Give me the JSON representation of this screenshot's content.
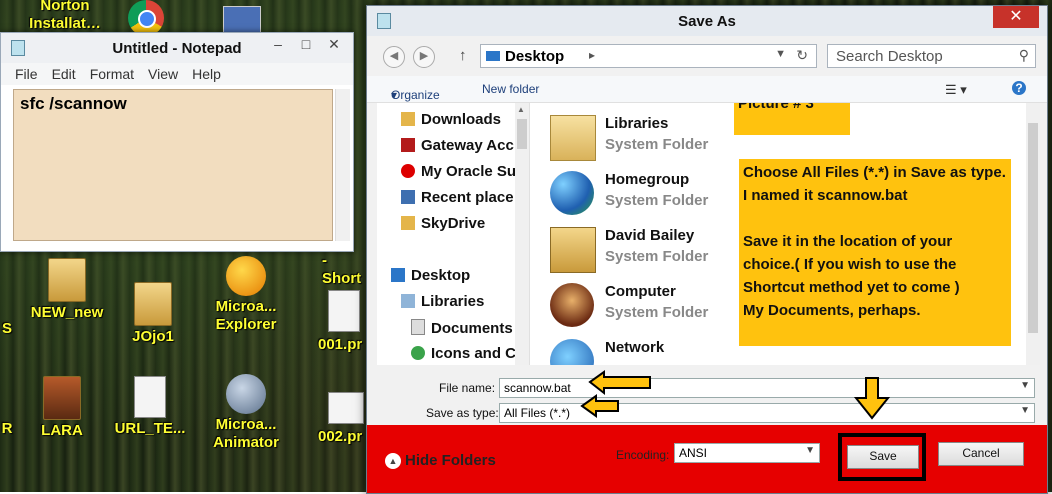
{
  "desktop_icons": [
    {
      "label": "Norton Installat…",
      "kind": "app"
    },
    {
      "label": "NEW_new",
      "kind": "folder"
    },
    {
      "label": "JOjo1",
      "kind": "folder"
    },
    {
      "label": "Microa... Explorer",
      "kind": "app"
    },
    {
      "label": "001.pr",
      "kind": "doc"
    },
    {
      "label": "LARA",
      "kind": "folder"
    },
    {
      "label": "URL_TE...",
      "kind": "doc"
    },
    {
      "label": "Microa... Animator",
      "kind": "app"
    },
    {
      "label": "002.pr",
      "kind": "doc"
    },
    {
      "label": "- Short",
      "kind": "text"
    },
    {
      "label": "S",
      "kind": "text"
    },
    {
      "label": "R",
      "kind": "text"
    }
  ],
  "notepad": {
    "title": "Untitled - Notepad",
    "menu": [
      "File",
      "Edit",
      "Format",
      "View",
      "Help"
    ],
    "content": "sfc /scannow"
  },
  "dialog": {
    "title": "Save As",
    "address": "Desktop",
    "search_placeholder": "Search Desktop",
    "organize": "Organize",
    "new_folder": "New folder",
    "nav_items": [
      {
        "label": "Downloads",
        "icon": "download-folder-icon"
      },
      {
        "label": "Gateway Acc",
        "icon": "gateway-icon"
      },
      {
        "label": "My Oracle Su",
        "icon": "oracle-icon"
      },
      {
        "label": "Recent place",
        "icon": "recent-places-icon"
      },
      {
        "label": "SkyDrive",
        "icon": "skydrive-icon"
      },
      {
        "label": "Desktop",
        "icon": "desktop-icon"
      },
      {
        "label": "Libraries",
        "icon": "libraries-icon"
      },
      {
        "label": "Documents",
        "icon": "documents-icon"
      },
      {
        "label": "Icons and C",
        "icon": "icons-folder-icon"
      }
    ],
    "files": [
      {
        "name": "Libraries",
        "type": "System Folder",
        "icon": "libraries-icon"
      },
      {
        "name": "Homegroup",
        "type": "System Folder",
        "icon": "homegroup-icon"
      },
      {
        "name": "David Bailey",
        "type": "System Folder",
        "icon": "user-folder-icon"
      },
      {
        "name": "Computer",
        "type": "System Folder",
        "icon": "computer-icon"
      },
      {
        "name": "Network",
        "type": "",
        "icon": "network-icon"
      }
    ],
    "notes": {
      "picture": "Picture # 3",
      "instructions": "Choose All Files (*.*) in Save as type.\nI named it scannow.bat\n\nSave it in the location of your choice.( If you wish to use the Shortcut method yet to come )\nMy Documents, perhaps."
    },
    "file_name_label": "File name:",
    "file_name_value": "scannow.bat",
    "save_type_label": "Save as type:",
    "save_type_value": "All Files  (*.*)",
    "hide_folders": "Hide Folders",
    "encoding_label": "Encoding:",
    "encoding_value": "ANSI",
    "save": "Save",
    "cancel": "Cancel"
  },
  "colors": {
    "note": "#ffc20e",
    "footer": "#e60000",
    "desktop_label": "#ffff33"
  }
}
